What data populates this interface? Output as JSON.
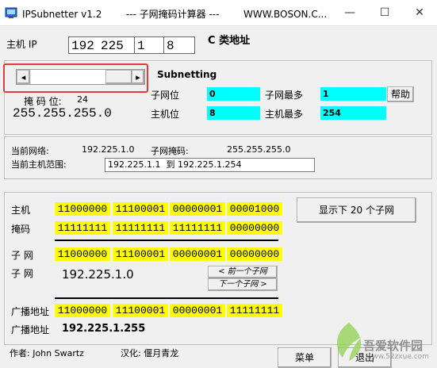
{
  "window": {
    "title": "IPSubnetter v1.2        --- 子网掩码计算器 ---        WWW.BOSON.C...",
    "minimize_glyph": "—",
    "maximize_glyph": "☐",
    "close_glyph": "✕"
  },
  "host_ip": {
    "label": "主机 IP",
    "octets": [
      "192",
      "225",
      "1",
      "8"
    ],
    "class_label": "C 类地址"
  },
  "subnetting": {
    "heading": "Subnetting",
    "slider_left_arrow": "◂",
    "slider_right_arrow": "▸",
    "mask_bits_label": "掩 码 位:",
    "mask_bits_value": "24",
    "mask": "255.255.255.0",
    "subnet_bits_label": "子网位",
    "subnet_bits_value": "0",
    "max_subnets_label": "子网最多",
    "max_subnets_value": "1",
    "host_bits_label": "主机位",
    "host_bits_value": "8",
    "max_hosts_label": "主机最多",
    "max_hosts_value": "254",
    "help_button": "帮助"
  },
  "network": {
    "current_network_label": "当前网络:",
    "current_network_value": "192.225.1.0",
    "subnet_mask_label": "子网掩码:",
    "subnet_mask_value": "255.255.255.0",
    "host_range_label": "当前主机范围:",
    "host_range_value": "192.225.1.1  到 192.225.1.254"
  },
  "binary": {
    "host_label": "主机",
    "host_bits": [
      "11000000",
      "11100001",
      "00000001",
      "00001000"
    ],
    "mask_label": "掩码",
    "mask_bits": [
      "11111111",
      "11111111",
      "11111111",
      "00000000"
    ],
    "subnet_label": "子 网",
    "subnet_bits": [
      "11000000",
      "11100001",
      "00000001",
      "00000000"
    ],
    "subnet_label2": "子 网",
    "subnet_address": "192.225.1.0",
    "prev_subnet_button": "< 前一个子网",
    "next_subnet_button": "下一个子网 >",
    "broadcast_label": "广播地址",
    "broadcast_bits": [
      "11000000",
      "11100001",
      "00000001",
      "11111111"
    ],
    "broadcast_label2": "广播地址",
    "broadcast_address": "192.225.1.255",
    "show_subnets_button": "显示下 20 个子网"
  },
  "footer": {
    "author": "作者: John Swartz",
    "translator": "汉化: 偃月青龙",
    "menu_button": "菜单",
    "exit_button": "退出"
  },
  "watermark": {
    "brand": "吾爱软件园",
    "url": "www.52zxue.com"
  },
  "colors": {
    "cyan": "#00ffff",
    "yellow": "#ffff00",
    "highlight_red": "#e23b3b"
  }
}
